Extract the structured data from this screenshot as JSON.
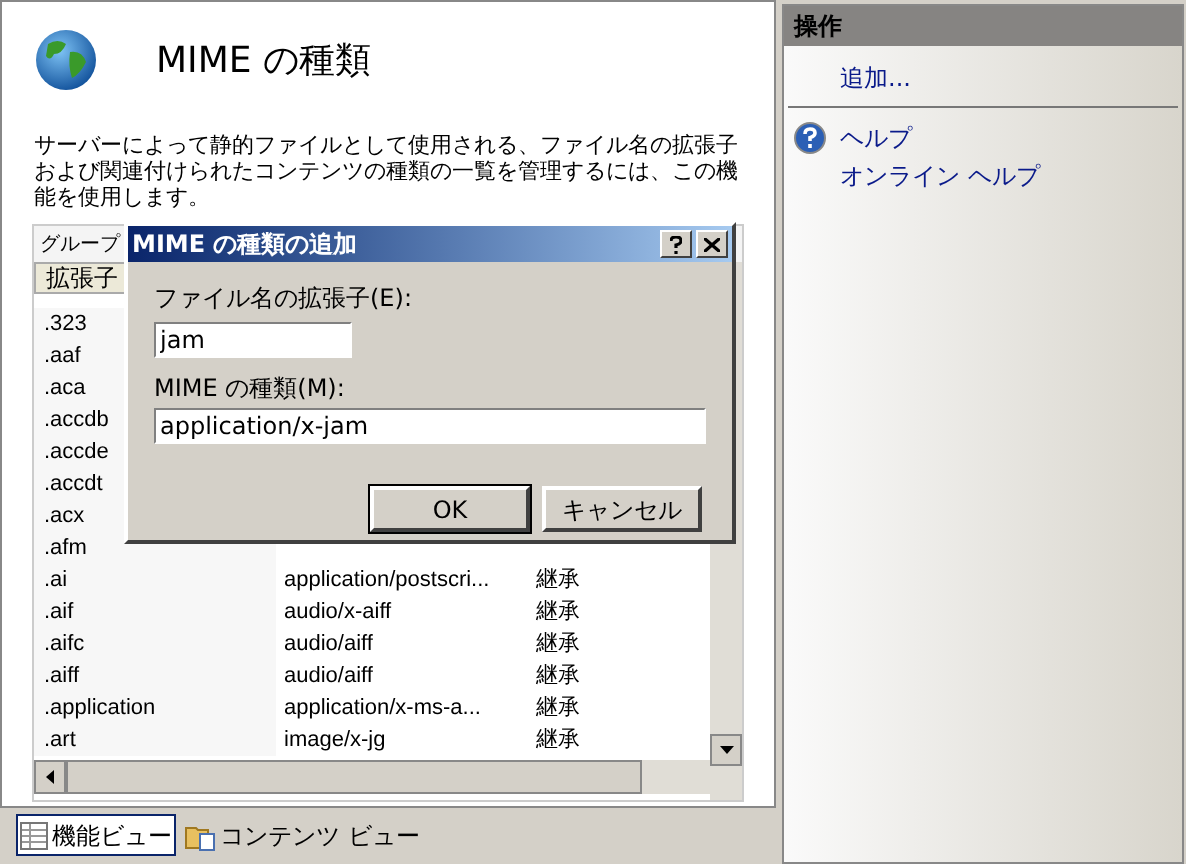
{
  "header": {
    "title": "MIME の種類"
  },
  "description": "サーバーによって静的ファイルとして使用される、ファイル名の拡張子および関連付けられたコンテンツの種類の一覧を管理するには、この機能を使用します。",
  "group_by": {
    "label": "グループ"
  },
  "table": {
    "columns": [
      "拡張子"
    ],
    "rows": [
      {
        "extension": ".323"
      },
      {
        "extension": ".aaf"
      },
      {
        "extension": ".aca"
      },
      {
        "extension": ".accdb"
      },
      {
        "extension": ".accde"
      },
      {
        "extension": ".accdt"
      },
      {
        "extension": ".acx"
      },
      {
        "extension": ".afm"
      },
      {
        "extension": ".ai",
        "mime_type": "application/postscri...",
        "entry_type": "継承"
      },
      {
        "extension": ".aif",
        "mime_type": "audio/x-aiff",
        "entry_type": "継承"
      },
      {
        "extension": ".aifc",
        "mime_type": "audio/aiff",
        "entry_type": "継承"
      },
      {
        "extension": ".aiff",
        "mime_type": "audio/aiff",
        "entry_type": "継承"
      },
      {
        "extension": ".application",
        "mime_type": "application/x-ms-a...",
        "entry_type": "継承"
      },
      {
        "extension": ".art",
        "mime_type": "image/x-jg",
        "entry_type": "継承"
      }
    ]
  },
  "dialog": {
    "title": "MIME の種類の追加",
    "extension_label": "ファイル名の拡張子(E):",
    "extension_value": "jam",
    "mime_label": "MIME の種類(M):",
    "mime_value": "application/x-jam",
    "buttons": [
      "OK",
      "キャンセル"
    ]
  },
  "view_tabs": [
    {
      "label": "機能ビュー",
      "kind": "features",
      "selected": true
    },
    {
      "label": "コンテンツ ビュー",
      "kind": "content",
      "selected": false
    }
  ],
  "actions": {
    "title": "操作",
    "items": [
      {
        "label": "追加...",
        "kind": "plain"
      },
      {
        "kind": "separator"
      },
      {
        "label": "ヘルプ",
        "kind": "help"
      },
      {
        "label": "オンライン ヘルプ",
        "kind": "plain"
      }
    ]
  }
}
